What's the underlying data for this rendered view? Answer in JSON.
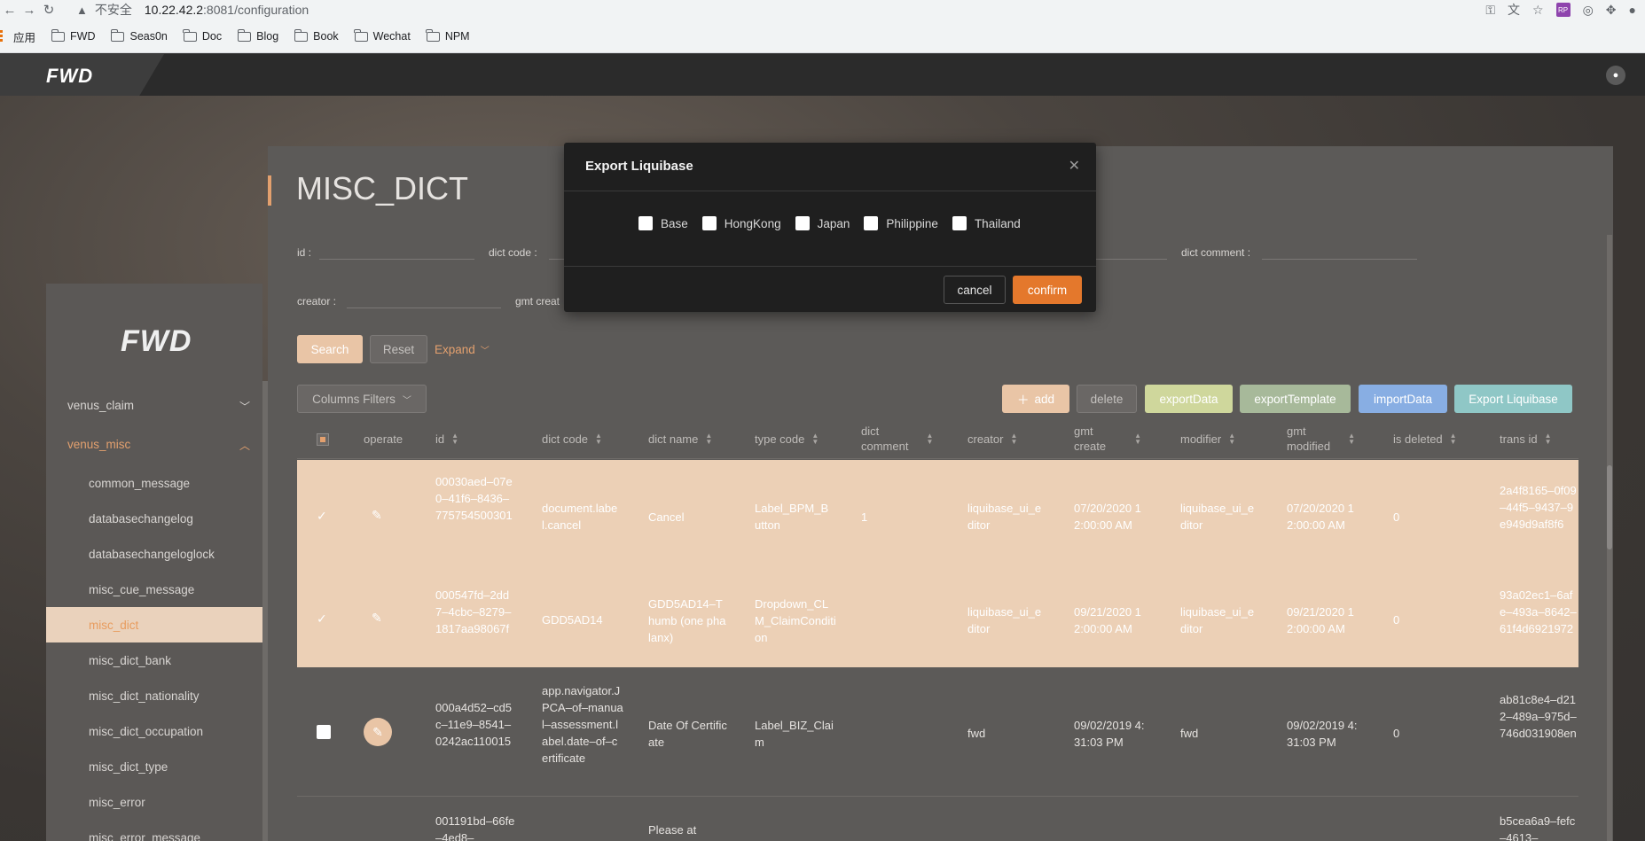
{
  "browser": {
    "insecure_label": "不安全",
    "url_host": "10.22.42.2",
    "url_path": ":8081/configuration",
    "bookmarks": [
      "应用",
      "FWD",
      "Seas0n",
      "Doc",
      "Blog",
      "Book",
      "Wechat",
      "NPM"
    ]
  },
  "header": {
    "logo": "FWD",
    "user_icon": "user-icon"
  },
  "sidebar": {
    "logo": "FWD",
    "groups": [
      {
        "label": "venus_claim",
        "expanded": false
      },
      {
        "label": "venus_misc",
        "expanded": true
      }
    ],
    "items": [
      {
        "label": "common_message"
      },
      {
        "label": "databasechangelog"
      },
      {
        "label": "databasechangeloglock"
      },
      {
        "label": "misc_cue_message"
      },
      {
        "label": "misc_dict",
        "active": true
      },
      {
        "label": "misc_dict_bank"
      },
      {
        "label": "misc_dict_nationality"
      },
      {
        "label": "misc_dict_occupation"
      },
      {
        "label": "misc_dict_type"
      },
      {
        "label": "misc_error"
      },
      {
        "label": "misc_error_message"
      }
    ]
  },
  "page": {
    "title": "MISC_DICT",
    "filters": {
      "id_label": "id :",
      "dict_code_label": "dict code :",
      "dict_comment_label": "dict comment :",
      "creator_label": "creator :",
      "gmt_create_label": "gmt creat"
    },
    "buttons": {
      "search": "Search",
      "reset": "Reset",
      "expand": "Expand",
      "columns_filters": "Columns Filters"
    },
    "toolbar": {
      "add": "add",
      "delete": "delete",
      "export_data": "exportData",
      "export_template": "exportTemplate",
      "import_data": "importData",
      "export_liquibase": "Export Liquibase"
    }
  },
  "table": {
    "columns": {
      "operate": "operate",
      "id": "id",
      "dict_code": "dict code",
      "dict_name": "dict name",
      "type_code": "type code",
      "dict_comment_1": "dict",
      "dict_comment_2": "comment",
      "creator": "creator",
      "gmt_create_1": "gmt",
      "gmt_create_2": "create",
      "modifier": "modifier",
      "gmt_modified_1": "gmt",
      "gmt_modified_2": "modified",
      "is_deleted": "is deleted",
      "trans_id": "trans id"
    },
    "rows": [
      {
        "id": "00030aed–07e0–41f6–8436–775754500301",
        "dict_code": "document.label.cancel",
        "dict_name": "Cancel",
        "type_code": "Label_BPM_Button",
        "dict_comment": "1",
        "creator": "liquibase_ui_editor",
        "gmt_create": "07/20/2020 12:00:00 AM",
        "modifier": "liquibase_ui_editor",
        "gmt_modified": "07/20/2020 12:00:00 AM",
        "is_deleted": "0",
        "trans_id": "2a4f8165–0f09–44f5–9437–9e949d9af8f6"
      },
      {
        "id": "000547fd–2dd7–4cbc–8279–1817aa98067f",
        "dict_code": "GDD5AD14",
        "dict_name": "GDD5AD14–Thumb (one phalanx)",
        "type_code": "Dropdown_CLM_ClaimCondition",
        "dict_comment": "",
        "creator": "liquibase_ui_editor",
        "gmt_create": "09/21/2020 12:00:00 AM",
        "modifier": "liquibase_ui_editor",
        "gmt_modified": "09/21/2020 12:00:00 AM",
        "is_deleted": "0",
        "trans_id": "93a02ec1–6afe–493a–8642–61f4d6921972"
      },
      {
        "id": "000a4d52–cd5c–11e9–8541–0242ac110015",
        "dict_code": "app.navigator.JPCA–of–manual–assessment.label.date–of–certificate",
        "dict_name": "Date Of Certificate",
        "type_code": "Label_BIZ_Claim",
        "dict_comment": "",
        "creator": "fwd",
        "gmt_create": "09/02/2019 4:31:03 PM",
        "modifier": "fwd",
        "gmt_modified": "09/02/2019 4:31:03 PM",
        "is_deleted": "0",
        "trans_id": "ab81c8e4–d212–489a–975d–746d031908en"
      },
      {
        "id": "001191bd–66fe–4ed8–",
        "dict_name": "Please at",
        "trans_id": "b5cea6a9–fefc–4613–"
      }
    ]
  },
  "modal": {
    "title": "Export Liquibase",
    "options": [
      "Base",
      "HongKong",
      "Japan",
      "Philippine",
      "Thailand"
    ],
    "cancel": "cancel",
    "confirm": "confirm"
  }
}
